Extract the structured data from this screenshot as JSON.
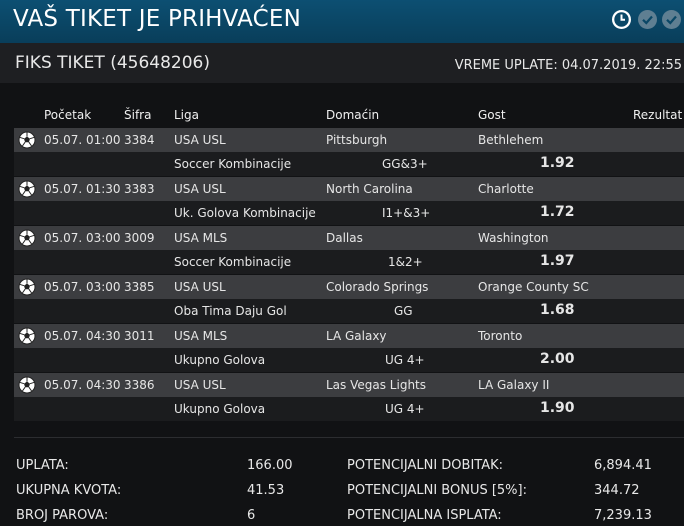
{
  "header": {
    "title": "VAŠ TIKET JE PRIHVAĆEN"
  },
  "ticket": {
    "label": "FIKS TIKET (45648206)",
    "time_label": "VREME UPLATE: 04.07.2019. 22:55"
  },
  "columns": {
    "start": "Početak",
    "code": "Šifra",
    "league": "Liga",
    "home": "Domaćin",
    "away": "Gost",
    "result": "Rezultat"
  },
  "matches": [
    {
      "date": "05.07. 01:00",
      "code": "3384",
      "league": "USA USL",
      "home": "Pittsburgh",
      "away": "Bethlehem",
      "bet_type": "Soccer Kombinacije",
      "pick": "GG&3+",
      "odd": "1.92"
    },
    {
      "date": "05.07. 01:30",
      "code": "3383",
      "league": "USA USL",
      "home": "North Carolina",
      "away": "Charlotte",
      "bet_type": "Uk. Golova Kombinacije",
      "pick": "I1+&3+",
      "odd": "1.72"
    },
    {
      "date": "05.07. 03:00",
      "code": "3009",
      "league": "USA MLS",
      "home": "Dallas",
      "away": "Washington",
      "bet_type": "Soccer Kombinacije",
      "pick": "1&2+",
      "odd": "1.97"
    },
    {
      "date": "05.07. 03:00",
      "code": "3385",
      "league": "USA USL",
      "home": "Colorado Springs",
      "away": "Orange County SC",
      "bet_type": "Oba Tima Daju Gol",
      "pick": "GG",
      "odd": "1.68"
    },
    {
      "date": "05.07. 04:30",
      "code": "3011",
      "league": "USA MLS",
      "home": "LA Galaxy",
      "away": "Toronto",
      "bet_type": "Ukupno Golova",
      "pick": "UG 4+",
      "odd": "2.00"
    },
    {
      "date": "05.07. 04:30",
      "code": "3386",
      "league": "USA USL",
      "home": "Las Vegas Lights",
      "away": "LA Galaxy II",
      "bet_type": "Ukupno Golova",
      "pick": "UG 4+",
      "odd": "1.90"
    }
  ],
  "summary": {
    "stake_label": "UPLATA:",
    "stake": "166.00",
    "total_odds_label": "UKUPNA KVOTA:",
    "total_odds": "41.53",
    "pairs_label": "BROJ PAROVA:",
    "pairs": "6",
    "pot_win_label": "POTENCIJALNI DOBITAK:",
    "pot_win": "6,894.41",
    "pot_bonus_label": "POTENCIJALNI BONUS [5%]:",
    "pot_bonus": "344.72",
    "pot_payout_label": "POTENCIJALNA ISPLATA:",
    "pot_payout": "7,239.13"
  },
  "icons": {
    "clock": "clock-icon",
    "check_1": "check-circle-icon",
    "check_2": "check-circle-icon",
    "sport": "soccer-ball-icon"
  },
  "colors": {
    "titlebar": "#0a4766",
    "row_main": "#3c3d40",
    "row_sub": "#1b1c1e"
  }
}
